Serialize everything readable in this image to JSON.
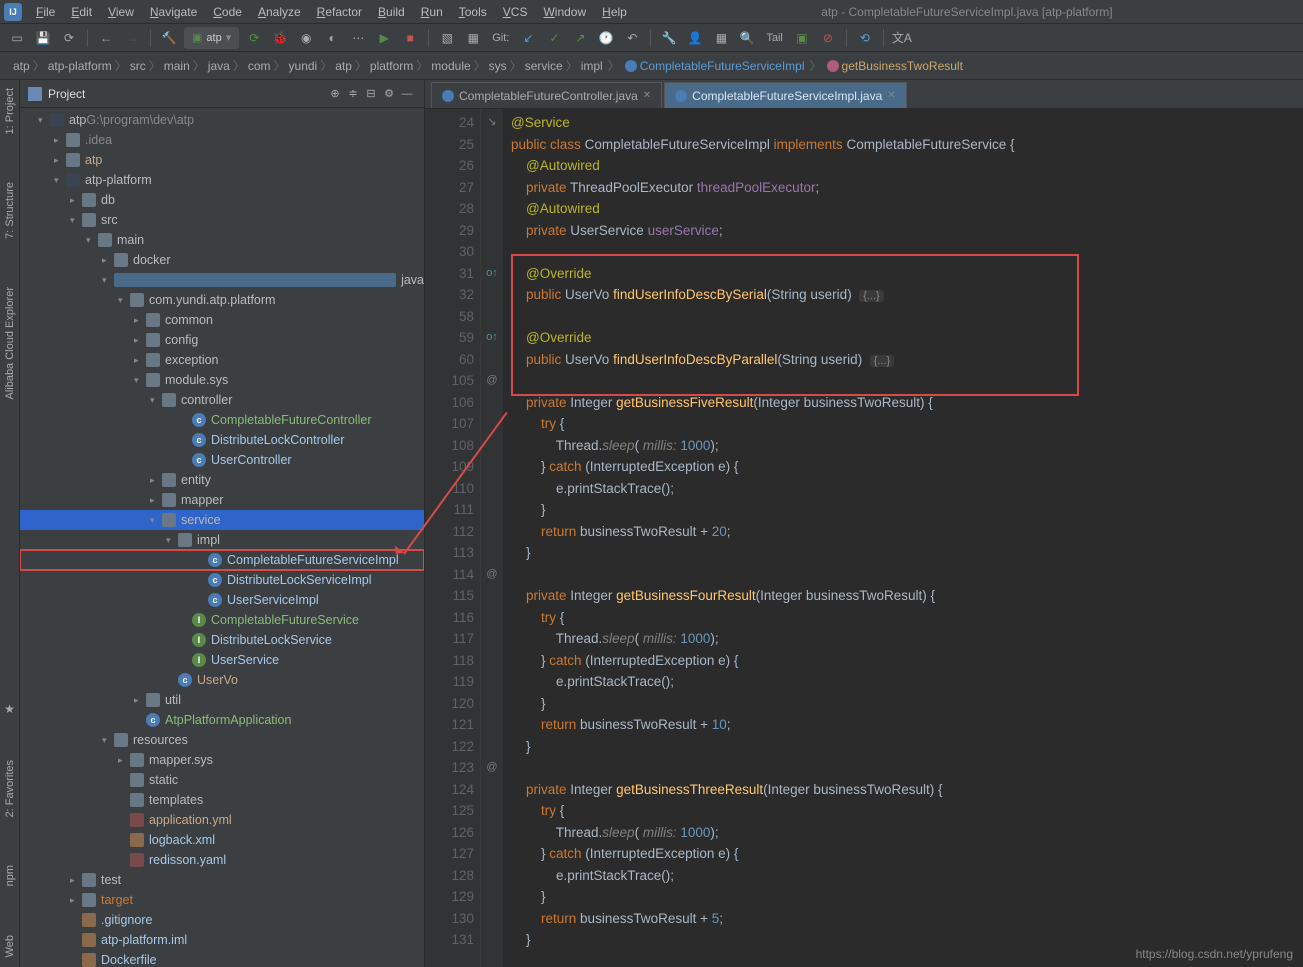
{
  "window": {
    "title": "atp - CompletableFutureServiceImpl.java [atp-platform]"
  },
  "menu": [
    "File",
    "Edit",
    "View",
    "Navigate",
    "Code",
    "Analyze",
    "Refactor",
    "Build",
    "Run",
    "Tools",
    "VCS",
    "Window",
    "Help"
  ],
  "runconfig": "atp",
  "toolbar": {
    "git": "Git:",
    "tail": "Tail"
  },
  "breadcrumb": [
    "atp",
    "atp-platform",
    "src",
    "main",
    "java",
    "com",
    "yundi",
    "atp",
    "platform",
    "module",
    "sys",
    "service",
    "impl"
  ],
  "breadcrumb_class": "CompletableFutureServiceImpl",
  "breadcrumb_method": "getBusinessTwoResult",
  "sidebar": {
    "project": "1: Project",
    "structure": "7: Structure",
    "alibaba": "Alibaba Cloud Explorer",
    "favorites": "2: Favorites",
    "npm": "npm",
    "web": "Web"
  },
  "projhdr": "Project",
  "tree": [
    {
      "ind": 18,
      "arr": "▾",
      "ico": "mod",
      "lbl": "atp",
      "dim": " G:\\program\\dev\\atp"
    },
    {
      "ind": 34,
      "arr": "▸",
      "ico": "fld",
      "lbl": ".idea",
      "cls": "dim"
    },
    {
      "ind": 34,
      "arr": "▸",
      "ico": "fld",
      "lbl": "atp",
      "cls": "yml"
    },
    {
      "ind": 34,
      "arr": "▾",
      "ico": "mod",
      "lbl": "atp-platform"
    },
    {
      "ind": 50,
      "arr": "▸",
      "ico": "fld",
      "lbl": "db"
    },
    {
      "ind": 50,
      "arr": "▾",
      "ico": "fld",
      "lbl": "src"
    },
    {
      "ind": 66,
      "arr": "▾",
      "ico": "fld",
      "lbl": "main"
    },
    {
      "ind": 82,
      "arr": "▸",
      "ico": "fld",
      "lbl": "docker"
    },
    {
      "ind": 82,
      "arr": "▾",
      "ico": "src",
      "lbl": "java"
    },
    {
      "ind": 98,
      "arr": "▾",
      "ico": "pkg",
      "lbl": "com.yundi.atp.platform"
    },
    {
      "ind": 114,
      "arr": "▸",
      "ico": "pkg",
      "lbl": "common"
    },
    {
      "ind": 114,
      "arr": "▸",
      "ico": "pkg",
      "lbl": "config"
    },
    {
      "ind": 114,
      "arr": "▸",
      "ico": "pkg",
      "lbl": "exception"
    },
    {
      "ind": 114,
      "arr": "▾",
      "ico": "pkg",
      "lbl": "module.sys"
    },
    {
      "ind": 130,
      "arr": "▾",
      "ico": "pkg",
      "lbl": "controller"
    },
    {
      "ind": 160,
      "ico": "cls",
      "lbl": "CompletableFutureController",
      "cls": "int"
    },
    {
      "ind": 160,
      "ico": "cls",
      "lbl": "DistributeLockController",
      "cls": "cls"
    },
    {
      "ind": 160,
      "ico": "cls",
      "lbl": "UserController",
      "cls": "cls"
    },
    {
      "ind": 130,
      "arr": "▸",
      "ico": "pkg",
      "lbl": "entity"
    },
    {
      "ind": 130,
      "arr": "▸",
      "ico": "pkg",
      "lbl": "mapper"
    },
    {
      "ind": 130,
      "arr": "▾",
      "ico": "pkg",
      "lbl": "service",
      "sel": true
    },
    {
      "ind": 146,
      "arr": "▾",
      "ico": "pkg",
      "lbl": "impl"
    },
    {
      "ind": 176,
      "ico": "cls",
      "lbl": "CompletableFutureServiceImpl",
      "cls": "cls",
      "hl": true
    },
    {
      "ind": 176,
      "ico": "cls",
      "lbl": "DistributeLockServiceImpl",
      "cls": "cls"
    },
    {
      "ind": 176,
      "ico": "cls",
      "lbl": "UserServiceImpl",
      "cls": "cls"
    },
    {
      "ind": 160,
      "ico": "int",
      "lbl": "CompletableFutureService",
      "cls": "int"
    },
    {
      "ind": 160,
      "ico": "int",
      "lbl": "DistributeLockService",
      "cls": "cls"
    },
    {
      "ind": 160,
      "ico": "int",
      "lbl": "UserService",
      "cls": "cls"
    },
    {
      "ind": 146,
      "ico": "cls",
      "lbl": "UserVo",
      "cls": "yml"
    },
    {
      "ind": 114,
      "arr": "▸",
      "ico": "pkg",
      "lbl": "util"
    },
    {
      "ind": 114,
      "ico": "cls",
      "lbl": "AtpPlatformApplication",
      "cls": "int"
    },
    {
      "ind": 82,
      "arr": "▾",
      "ico": "fld",
      "lbl": "resources"
    },
    {
      "ind": 98,
      "arr": "▸",
      "ico": "fld",
      "lbl": "mapper.sys"
    },
    {
      "ind": 98,
      "ico": "fld",
      "lbl": "static"
    },
    {
      "ind": 98,
      "ico": "fld",
      "lbl": "templates"
    },
    {
      "ind": 98,
      "ico": "yml",
      "lbl": "application.yml",
      "cls": "yml"
    },
    {
      "ind": 98,
      "ico": "xml",
      "lbl": "logback.xml",
      "cls": "cls"
    },
    {
      "ind": 98,
      "ico": "yml",
      "lbl": "redisson.yaml",
      "cls": "cls"
    },
    {
      "ind": 50,
      "arr": "▸",
      "ico": "fld",
      "lbl": "test"
    },
    {
      "ind": 50,
      "arr": "▸",
      "ico": "fld",
      "lbl": "target",
      "cls": "tgt"
    },
    {
      "ind": 50,
      "ico": "xml",
      "lbl": ".gitignore",
      "cls": "cls"
    },
    {
      "ind": 50,
      "ico": "xml",
      "lbl": "atp-platform.iml",
      "cls": "cls"
    },
    {
      "ind": 50,
      "ico": "xml",
      "lbl": "Dockerfile",
      "cls": "cls"
    }
  ],
  "tabs": [
    {
      "label": "CompletableFutureController.java",
      "active": false
    },
    {
      "label": "CompletableFutureServiceImpl.java",
      "active": true
    }
  ],
  "lines": [
    24,
    25,
    26,
    27,
    28,
    29,
    30,
    31,
    32,
    58,
    59,
    60,
    105,
    106,
    107,
    108,
    109,
    110,
    111,
    112,
    113,
    114,
    115,
    116,
    117,
    118,
    119,
    120,
    121,
    122,
    123,
    124,
    125,
    126,
    127,
    128,
    129,
    130,
    131
  ],
  "markers": {
    "1": "↘",
    "2": "",
    "3": "",
    "4": "",
    "8": "o↑",
    "11": "o↑",
    "13": "@",
    "22": "@",
    "31": "@"
  },
  "code": {
    "l0": "@Service",
    "l1_a": "public",
    "l1_b": "class",
    "l1_c": "CompletableFutureServiceImpl",
    "l1_d": "implements",
    "l1_e": "CompletableFutureService",
    "l1_f": "{",
    "l2": "@Autowired",
    "l3_a": "private",
    "l3_b": "ThreadPoolExecutor",
    "l3_c": "threadPoolExecutor",
    "l3_d": ";",
    "l4": "@Autowired",
    "l5_a": "private",
    "l5_b": "UserService",
    "l5_c": "userService",
    "l5_d": ";",
    "l7": "@Override",
    "l8_a": "public",
    "l8_b": "UserVo",
    "l8_c": "findUserInfoDescBySerial",
    "l8_d": "(String userid)",
    "l8_e": "{...}",
    "l10": "@Override",
    "l11_a": "public",
    "l11_b": "UserVo",
    "l11_c": "findUserInfoDescByParallel",
    "l11_d": "(String userid)",
    "l11_e": "{...}",
    "l13_a": "private",
    "l13_b": "Integer",
    "l13_c": "getBusinessFiveResult",
    "l13_d": "(Integer businessTwoResult) {",
    "l14_a": "try",
    "l14_b": "{",
    "l15_a": "Thread.",
    "l15_b": "sleep",
    "l15_c": "(",
    "l15_d": " millis: ",
    "l15_e": "1000",
    "l15_f": ");",
    "l16_a": "}",
    "l16_b": "catch",
    "l16_c": "(InterruptedException e) {",
    "l17": "e.printStackTrace();",
    "l18": "}",
    "l19_a": "return",
    "l19_b": "businessTwoResult + ",
    "l19_c": "20",
    "l19_d": ";",
    "l20": "}",
    "l22_a": "private",
    "l22_b": "Integer",
    "l22_c": "getBusinessFourResult",
    "l22_d": "(Integer businessTwoResult) {",
    "l23_a": "try",
    "l23_b": "{",
    "l24_a": "Thread.",
    "l24_b": "sleep",
    "l24_c": "(",
    "l24_d": " millis: ",
    "l24_e": "1000",
    "l24_f": ");",
    "l25_a": "}",
    "l25_b": "catch",
    "l25_c": "(InterruptedException e) {",
    "l26": "e.printStackTrace();",
    "l27": "}",
    "l28_a": "return",
    "l28_b": "businessTwoResult + ",
    "l28_c": "10",
    "l28_d": ";",
    "l29": "}",
    "l31_a": "private",
    "l31_b": "Integer",
    "l31_c": "getBusinessThreeResult",
    "l31_d": "(Integer businessTwoResult) {",
    "l32_a": "try",
    "l32_b": "{",
    "l33_a": "Thread.",
    "l33_b": "sleep",
    "l33_c": "(",
    "l33_d": " millis: ",
    "l33_e": "1000",
    "l33_f": ");",
    "l34_a": "}",
    "l34_b": "catch",
    "l34_c": "(InterruptedException e) {",
    "l35": "e.printStackTrace();",
    "l36": "}",
    "l37_a": "return",
    "l37_b": "businessTwoResult + ",
    "l37_c": "5",
    "l37_d": ";",
    "l38": "}"
  },
  "watermark": "https://blog.csdn.net/yprufeng"
}
